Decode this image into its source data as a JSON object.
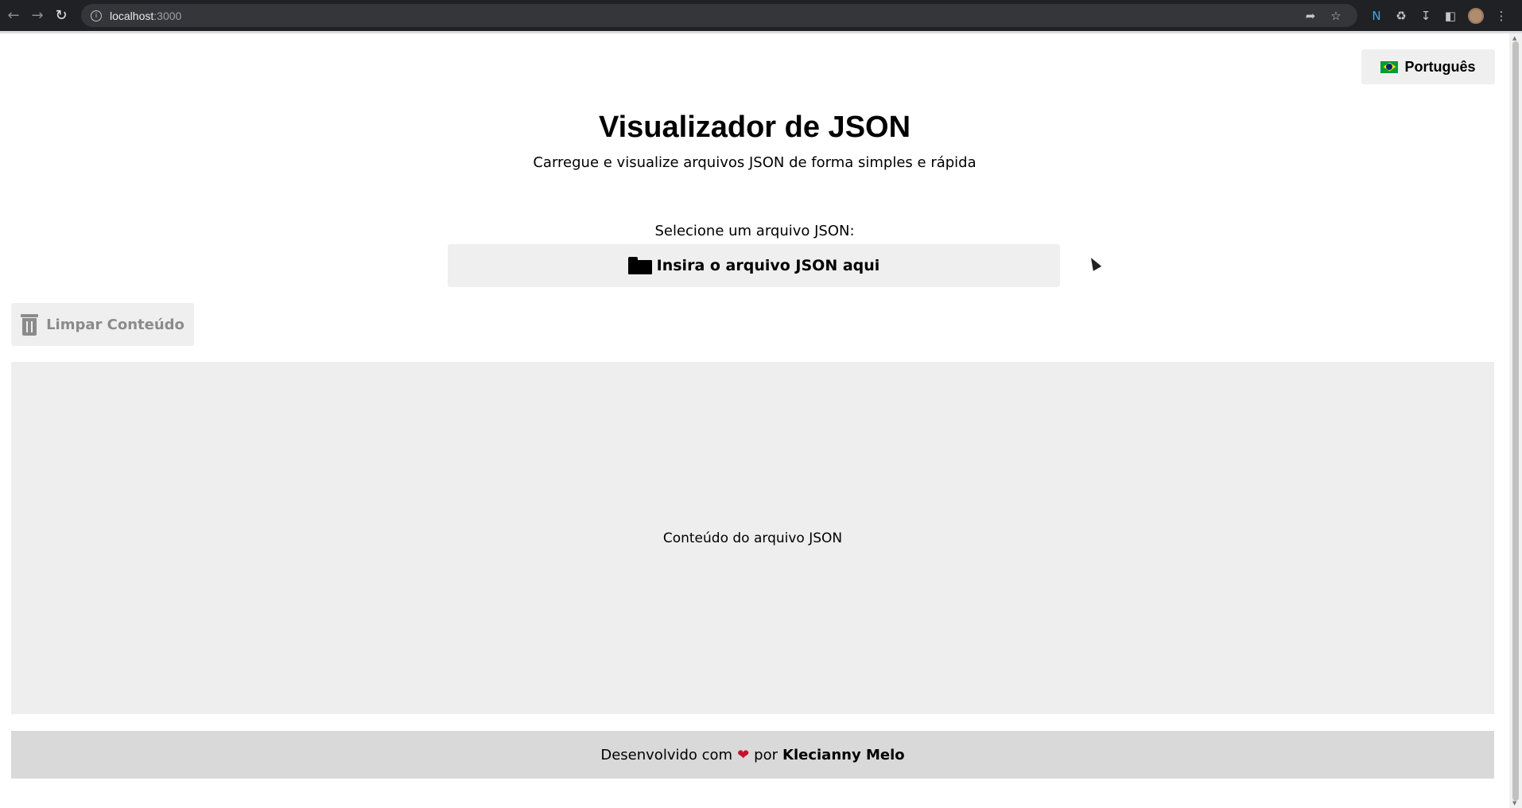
{
  "browser": {
    "url_host": "localhost",
    "url_port": ":3000"
  },
  "header": {
    "language_label": "Português"
  },
  "main": {
    "title": "Visualizador de JSON",
    "subtitle": "Carregue e visualize arquivos JSON de forma simples e rápida",
    "select_label": "Selecione um arquivo JSON:",
    "upload_label": "Insira o arquivo JSON aqui",
    "clear_label": "Limpar Conteúdo",
    "content_placeholder": "Conteúdo do arquivo JSON"
  },
  "footer": {
    "prefix": "Desenvolvido com",
    "middle": "por",
    "author": "Klecianny Melo"
  },
  "icons": {
    "flag": "brazil-flag-icon",
    "folder": "folder-icon",
    "trash": "trash-icon",
    "heart": "anatomical-heart-icon"
  },
  "colors": {
    "button_bg": "#efefef",
    "content_bg": "#eeeeee",
    "footer_bg": "#d9d9d9",
    "disabled_text": "#8b8b8b"
  }
}
